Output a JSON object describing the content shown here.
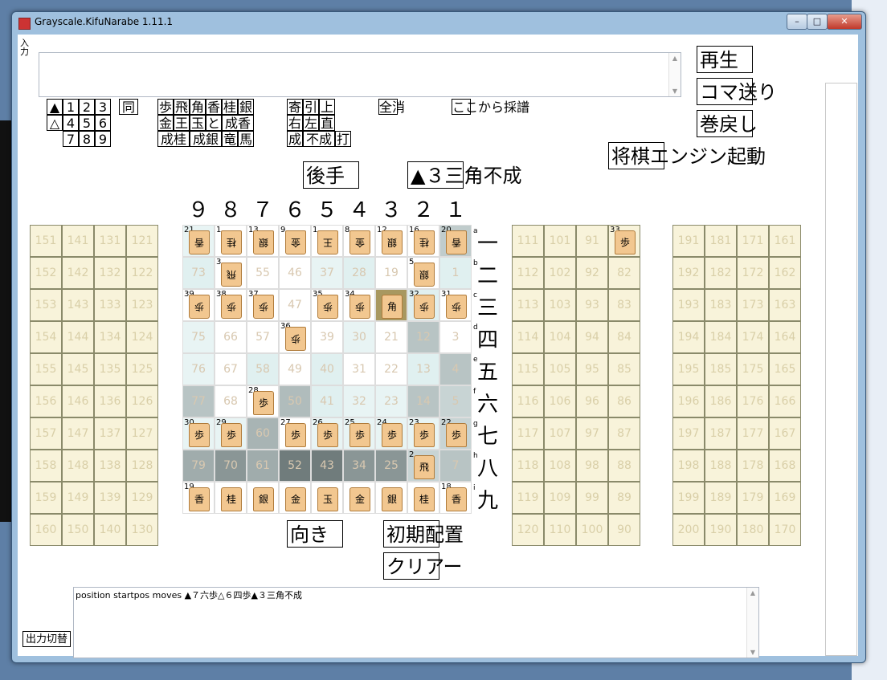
{
  "window": {
    "title": "Grayscale.KifuNarabe 1.11.1",
    "min": "–",
    "max": "□",
    "close": "✕"
  },
  "input": {
    "label": "入力",
    "value": ""
  },
  "keypad": {
    "sente_mark": "▲",
    "gote_mark": "△",
    "num_row1": [
      "1",
      "2",
      "3"
    ],
    "num_row2": [
      "4",
      "5",
      "6"
    ],
    "num_row3": [
      "7",
      "8",
      "9"
    ],
    "same": "同",
    "pieces_row1": [
      "歩",
      "飛",
      "角",
      "香",
      "桂",
      "銀"
    ],
    "pieces_row2": [
      "金",
      "王",
      "玉",
      "と",
      "成香"
    ],
    "pieces_row3": [
      "成桂",
      "成銀",
      "竜",
      "馬"
    ],
    "move_row1": [
      "寄",
      "引",
      "上"
    ],
    "move_row2": [
      "右",
      "左",
      "直"
    ],
    "move_row3": [
      "成",
      "不成",
      "打"
    ],
    "clear_all": "全消",
    "record_from_here": "ここから採譜"
  },
  "controls": {
    "play": "再生",
    "step": "コマ送り",
    "rewind": "巻戻し",
    "engine": "将棋エンジン起動",
    "turn": "後手",
    "last_move": "▲３三角不成",
    "direction": "向き",
    "initial": "初期配置",
    "clear": "クリアー",
    "output_toggle": "出力切替"
  },
  "board": {
    "col_labels": [
      "９",
      "８",
      "７",
      "６",
      "５",
      "４",
      "３",
      "２",
      "１"
    ],
    "row_labels": [
      "一",
      "二",
      "三",
      "四",
      "五",
      "六",
      "七",
      "八",
      "九"
    ],
    "row_letters": [
      "a",
      "b",
      "c",
      "d",
      "e",
      "f",
      "g",
      "h",
      "i"
    ],
    "squares": [
      [
        {
          "n": "21",
          "p": "香",
          "g": true
        },
        {
          "n": "1",
          "p": "桂",
          "g": true
        },
        {
          "n": "13",
          "p": "銀",
          "g": true
        },
        {
          "n": "9",
          "p": "金",
          "g": true
        },
        {
          "n": "1",
          "p": "王",
          "g": true
        },
        {
          "n": "8",
          "p": "金",
          "g": true
        },
        {
          "n": "12",
          "p": "銀",
          "g": true
        },
        {
          "n": "16",
          "p": "桂",
          "g": true
        },
        {
          "n": "20",
          "p": "香",
          "g": true
        }
      ],
      [
        {
          "n": "73"
        },
        {
          "n": "3",
          "p": "飛",
          "g": true
        },
        {
          "n": "55"
        },
        {
          "n": "46"
        },
        {
          "n": "37"
        },
        {
          "n": "28"
        },
        {
          "n": "19"
        },
        {
          "n": "5",
          "p": "銀",
          "g": true
        },
        {
          "n": "1"
        }
      ],
      [
        {
          "n": "39",
          "p": "歩",
          "g": true
        },
        {
          "n": "38",
          "p": "歩",
          "g": true
        },
        {
          "n": "37",
          "p": "歩",
          "g": true
        },
        {
          "n": "47"
        },
        {
          "n": "35",
          "p": "歩",
          "g": true
        },
        {
          "n": "34",
          "p": "歩",
          "g": true
        },
        {
          "n": "",
          "p": "角",
          "g": false
        },
        {
          "n": "32",
          "p": "歩",
          "g": true
        },
        {
          "n": "31",
          "p": "歩",
          "g": true
        }
      ],
      [
        {
          "n": "75"
        },
        {
          "n": "66"
        },
        {
          "n": "57"
        },
        {
          "n": "36",
          "p": "歩",
          "g": true
        },
        {
          "n": "39"
        },
        {
          "n": "30"
        },
        {
          "n": "21"
        },
        {
          "n": "12"
        },
        {
          "n": "3"
        }
      ],
      [
        {
          "n": "76"
        },
        {
          "n": "67"
        },
        {
          "n": "58"
        },
        {
          "n": "49"
        },
        {
          "n": "40"
        },
        {
          "n": "31"
        },
        {
          "n": "22"
        },
        {
          "n": "13"
        },
        {
          "n": "4"
        }
      ],
      [
        {
          "n": "77"
        },
        {
          "n": "68"
        },
        {
          "n": "28",
          "p": "歩",
          "g": false
        },
        {
          "n": "50"
        },
        {
          "n": "41"
        },
        {
          "n": "32"
        },
        {
          "n": "23"
        },
        {
          "n": "14"
        },
        {
          "n": "5"
        }
      ],
      [
        {
          "n": "30",
          "p": "歩",
          "g": false
        },
        {
          "n": "29",
          "p": "歩",
          "g": false
        },
        {
          "n": "60"
        },
        {
          "n": "27",
          "p": "歩",
          "g": false
        },
        {
          "n": "26",
          "p": "歩",
          "g": false
        },
        {
          "n": "25",
          "p": "歩",
          "g": false
        },
        {
          "n": "24",
          "p": "歩",
          "g": false
        },
        {
          "n": "23",
          "p": "歩",
          "g": false
        },
        {
          "n": "22",
          "p": "歩",
          "g": false
        }
      ],
      [
        {
          "n": "79"
        },
        {
          "n": "70"
        },
        {
          "n": "61"
        },
        {
          "n": "52"
        },
        {
          "n": "43"
        },
        {
          "n": "34"
        },
        {
          "n": "25"
        },
        {
          "n": "2",
          "p": "飛",
          "g": false
        },
        {
          "n": "7"
        }
      ],
      [
        {
          "n": "19",
          "p": "香",
          "g": false
        },
        {
          "n": "",
          "p": "桂",
          "g": false
        },
        {
          "n": "",
          "p": "銀",
          "g": false
        },
        {
          "n": "",
          "p": "金",
          "g": false
        },
        {
          "n": "",
          "p": "玉",
          "g": false
        },
        {
          "n": "",
          "p": "金",
          "g": false
        },
        {
          "n": "",
          "p": "銀",
          "g": false
        },
        {
          "n": "",
          "p": "桂",
          "g": false
        },
        {
          "n": "18",
          "p": "香",
          "g": false
        }
      ]
    ],
    "shades": [
      [
        "#e8f4f4",
        "#fff",
        "#fff",
        "#fff",
        "#fff",
        "#fff",
        "#fff",
        "#fff",
        "#c0cccc"
      ],
      [
        "#e0f0f0",
        "#fff",
        "#fff",
        "#fff",
        "#e8f4f4",
        "#e0f0f0",
        "#fff",
        "#fff",
        "#e0f0f0"
      ],
      [
        "#fff",
        "#fff",
        "#fff",
        "#fff",
        "#fff",
        "#fff",
        "#a89860",
        "#e0f0f0",
        "#fff"
      ],
      [
        "#e8f4f4",
        "#fff",
        "#fff",
        "#fff",
        "#fff",
        "#e8f4f4",
        "#fff",
        "#b8c4c4",
        "#fff"
      ],
      [
        "#e8f4f4",
        "#fff",
        "#e0f0f0",
        "#fff",
        "#e0f0f0",
        "#fff",
        "#fff",
        "#e0f0f0",
        "#b8c4c4"
      ],
      [
        "#b8c4c4",
        "#fff",
        "#fff",
        "#b0bcbc",
        "#e0f0f0",
        "#e8f4f4",
        "#e8f4f4",
        "#b8c4c4",
        "#c8d4d4"
      ],
      [
        "#e8f4f4",
        "#e8f4f4",
        "#a8b4b4",
        "#fff",
        "#e8f4f4",
        "#e8f4f4",
        "#e8f4f4",
        "#e8f4f4",
        "#c8d4d4"
      ],
      [
        "#a0acac",
        "#8a9696",
        "#a0acac",
        "#707c7c",
        "#707c7c",
        "#8a9696",
        "#8a9696",
        "#c8d4d4",
        "#b8c4c4"
      ],
      [
        "#fff",
        "#fff",
        "#fff",
        "#fff",
        "#fff",
        "#fff",
        "#fff",
        "#fff",
        "#fff"
      ]
    ]
  },
  "left_stand": [
    [
      "151",
      "141",
      "131",
      "121"
    ],
    [
      "152",
      "142",
      "132",
      "122"
    ],
    [
      "153",
      "143",
      "133",
      "123"
    ],
    [
      "154",
      "144",
      "134",
      "124"
    ],
    [
      "155",
      "145",
      "135",
      "125"
    ],
    [
      "156",
      "146",
      "136",
      "126"
    ],
    [
      "157",
      "147",
      "137",
      "127"
    ],
    [
      "158",
      "148",
      "138",
      "128"
    ],
    [
      "159",
      "149",
      "139",
      "129"
    ],
    [
      "160",
      "150",
      "140",
      "130"
    ]
  ],
  "mid_stand": [
    [
      "111",
      "101",
      "91",
      "33"
    ],
    [
      "112",
      "102",
      "92",
      "82"
    ],
    [
      "113",
      "103",
      "93",
      "83"
    ],
    [
      "114",
      "104",
      "94",
      "84"
    ],
    [
      "115",
      "105",
      "95",
      "85"
    ],
    [
      "116",
      "106",
      "96",
      "86"
    ],
    [
      "117",
      "107",
      "97",
      "87"
    ],
    [
      "118",
      "108",
      "98",
      "88"
    ],
    [
      "119",
      "109",
      "99",
      "89"
    ],
    [
      "120",
      "110",
      "100",
      "90"
    ]
  ],
  "right_stand": [
    [
      "191",
      "181",
      "171",
      "161"
    ],
    [
      "192",
      "182",
      "172",
      "162"
    ],
    [
      "193",
      "183",
      "173",
      "163"
    ],
    [
      "194",
      "184",
      "174",
      "164"
    ],
    [
      "195",
      "185",
      "175",
      "165"
    ],
    [
      "196",
      "186",
      "176",
      "166"
    ],
    [
      "197",
      "187",
      "177",
      "167"
    ],
    [
      "198",
      "188",
      "178",
      "168"
    ],
    [
      "199",
      "189",
      "179",
      "169"
    ],
    [
      "200",
      "190",
      "180",
      "170"
    ]
  ],
  "output": {
    "text": "position startpos moves ▲７六歩△６四歩▲３三角不成"
  }
}
